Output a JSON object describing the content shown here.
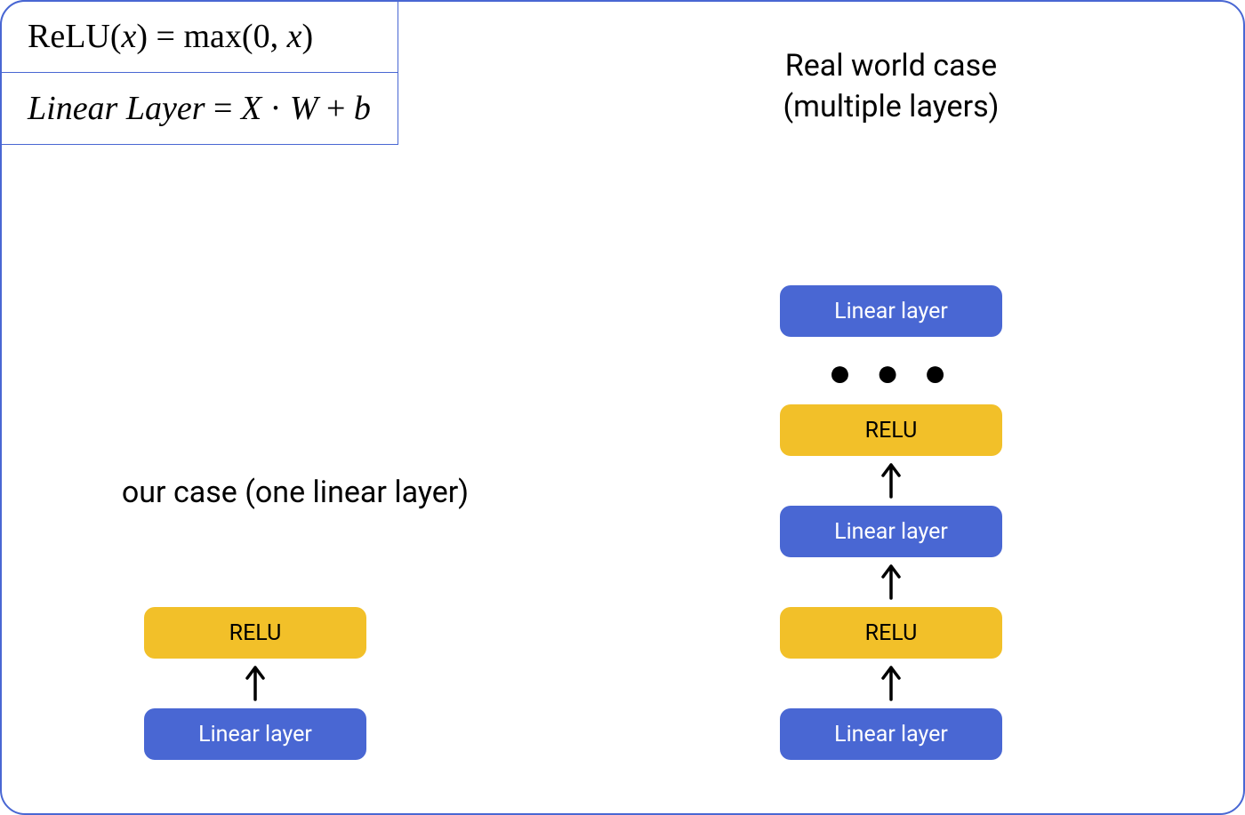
{
  "formulas": {
    "relu_lhs": "ReLU(",
    "relu_var": "x",
    "relu_mid": ") = max(0, ",
    "relu_var2": "x",
    "relu_rhs": ")",
    "linear_lhs": "Linear  Layer",
    "linear_eq": " = ",
    "linear_X": "X",
    "linear_dot": " · ",
    "linear_W": "W",
    "linear_plus": " + ",
    "linear_b": "b"
  },
  "headings": {
    "left": "our case (one linear layer)",
    "right_line1": "Real world case",
    "right_line2": "(multiple layers)"
  },
  "labels": {
    "linear": "Linear layer",
    "relu": "RELU",
    "ellipsis": "● ● ●"
  },
  "colors": {
    "border": "#4967d3",
    "linear_bg": "#4967d3",
    "relu_bg": "#f2c029"
  }
}
